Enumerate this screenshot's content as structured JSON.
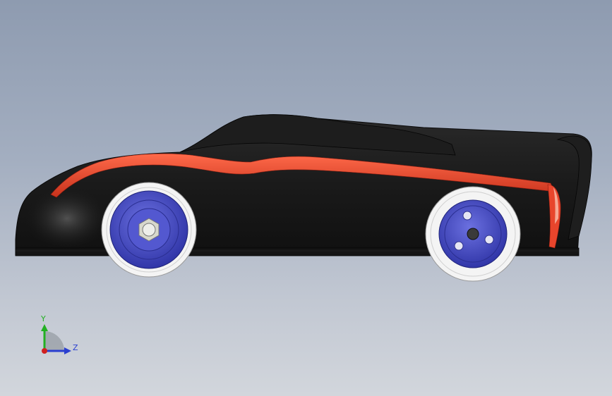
{
  "view": {
    "background_top": "#8e9bb0",
    "background_bottom": "#d2d6dc"
  },
  "model": {
    "body_color": "#141414",
    "stripe_color": "#e8452c",
    "wheel_hub_color": "#4a4fc8",
    "tire_color": "#f4f4f4"
  },
  "triad": {
    "y_label": "Y",
    "z_label": "Z",
    "y_axis_color": "#22b022",
    "z_axis_color": "#2a3fd0",
    "x_axis_color": "#d02020"
  }
}
